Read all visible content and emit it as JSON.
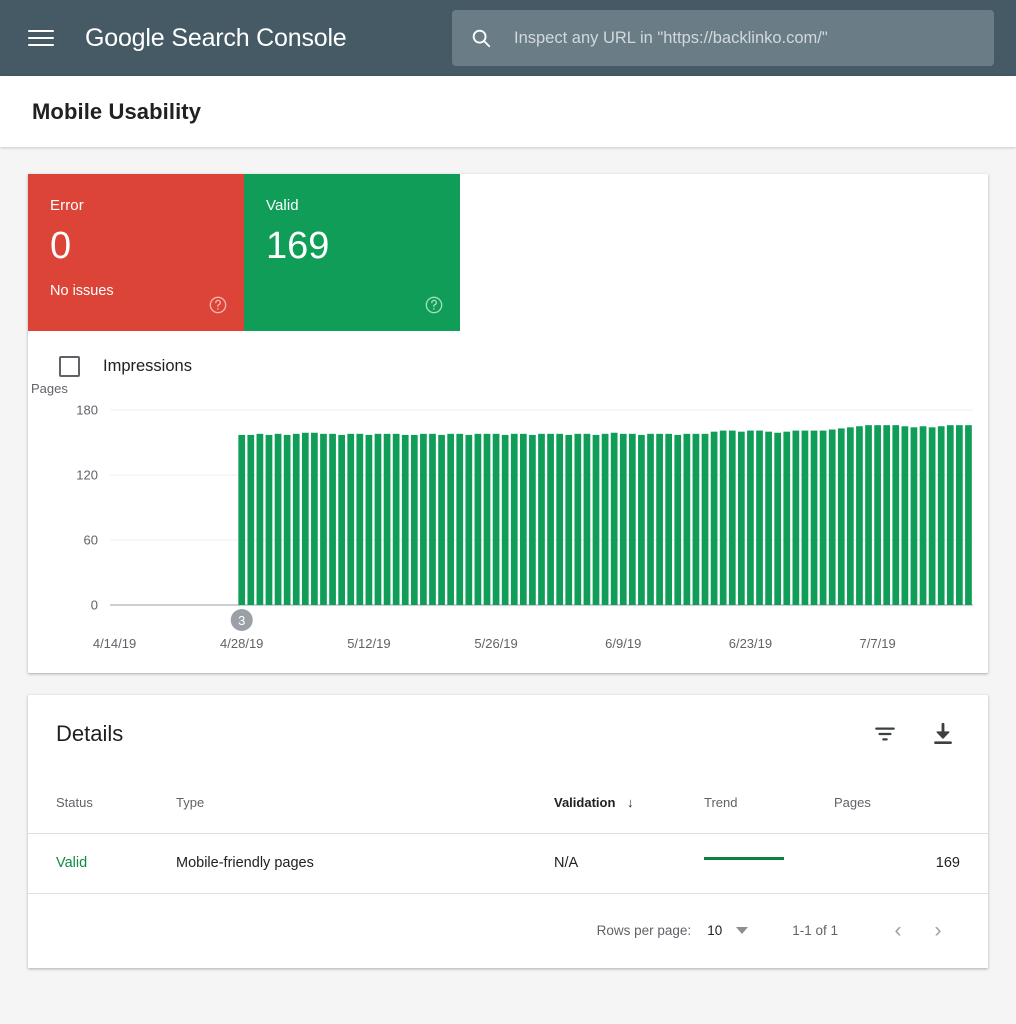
{
  "appbar": {
    "menu_icon": "hamburger-menu-icon",
    "brand_primary": "Google",
    "brand_secondary": "Search Console",
    "search": {
      "icon": "search-icon",
      "placeholder": "Inspect any URL in \"https://backlinko.com/\"",
      "value": ""
    }
  },
  "page": {
    "title": "Mobile Usability"
  },
  "summary": {
    "cards": [
      {
        "label": "Error",
        "value": "0",
        "sub": "No issues",
        "color": "#db4437",
        "help_icon": "help-circle-icon"
      },
      {
        "label": "Valid",
        "value": "169",
        "sub": "",
        "color": "#0f9d58",
        "help_icon": "help-circle-icon"
      }
    ]
  },
  "legend": {
    "impressions_label": "Impressions",
    "impressions_checked": false
  },
  "chart_data": {
    "type": "bar",
    "title": "",
    "subtitle": "",
    "xlabel": "",
    "ylabel": "Pages",
    "grid": true,
    "legend_position": "top-left",
    "legend": [
      "Impressions"
    ],
    "series_color": "#0f9d58",
    "ylim": [
      0,
      180
    ],
    "yticks": [
      0,
      60,
      120,
      180
    ],
    "ytick_labels": [
      "0",
      "60",
      "120",
      "180"
    ],
    "xtick_labels": [
      "4/14/19",
      "4/28/19",
      "5/12/19",
      "5/26/19",
      "6/9/19",
      "6/23/19",
      "7/7/19"
    ],
    "x_start_date": "4/14/19",
    "x_end_date": "7/14/19",
    "annotations": [
      {
        "label": "3",
        "x_date": "4/28/19",
        "shape": "circle-badge",
        "color": "#9aa0a6"
      }
    ],
    "bars_start_index": 14,
    "values": [
      0,
      0,
      0,
      0,
      0,
      0,
      0,
      0,
      0,
      0,
      0,
      0,
      0,
      0,
      157,
      157,
      158,
      157,
      158,
      157,
      158,
      159,
      159,
      158,
      158,
      157,
      158,
      158,
      157,
      158,
      158,
      158,
      157,
      157,
      158,
      158,
      157,
      158,
      158,
      157,
      158,
      158,
      158,
      157,
      158,
      158,
      157,
      158,
      158,
      158,
      157,
      158,
      158,
      157,
      158,
      159,
      158,
      158,
      157,
      158,
      158,
      158,
      157,
      158,
      158,
      158,
      160,
      161,
      161,
      160,
      161,
      161,
      160,
      159,
      160,
      161,
      161,
      161,
      161,
      162,
      163,
      164,
      165,
      166,
      166,
      166,
      166,
      165,
      164,
      165,
      164,
      165,
      166,
      166,
      166
    ]
  },
  "details": {
    "heading": "Details",
    "filter_icon": "filter-icon",
    "download_icon": "download-icon",
    "columns": [
      {
        "key": "status",
        "label": "Status",
        "sorted": false
      },
      {
        "key": "type",
        "label": "Type",
        "sorted": false
      },
      {
        "key": "validation",
        "label": "Validation",
        "sorted": true,
        "sort_icon": "arrow-down-icon"
      },
      {
        "key": "trend",
        "label": "Trend",
        "sorted": false
      },
      {
        "key": "pages",
        "label": "Pages",
        "sorted": false
      }
    ],
    "rows": [
      {
        "status": "Valid",
        "status_color": "#0f8a46",
        "type": "Mobile-friendly pages",
        "validation": "N/A",
        "trend": "flat",
        "pages": "169"
      }
    ],
    "pagination": {
      "rows_per_page_label": "Rows per page:",
      "rows_per_page_value": "10",
      "range": "1-1 of 1",
      "prev_icon": "chevron-left-icon",
      "next_icon": "chevron-right-icon"
    }
  }
}
